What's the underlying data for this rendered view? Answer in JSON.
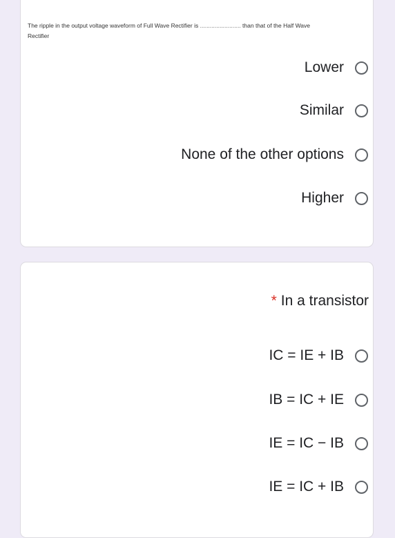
{
  "question1": {
    "text_before": "The ripple in the output voltage waveform of Full Wave Rectifier is",
    "blank": ".........................",
    "text_after": "than that of the Half Wave Rectifier",
    "options": [
      {
        "label": "Lower",
        "selected": false
      },
      {
        "label": "Similar",
        "selected": false
      },
      {
        "label": "None of the other options",
        "selected": false
      },
      {
        "label": "Higher",
        "selected": false
      }
    ]
  },
  "question2": {
    "required_marker": "*",
    "text": "In a transistor",
    "options": [
      {
        "label": "IC = IE + IB",
        "selected": false
      },
      {
        "label": "IB = IC + IE",
        "selected": false
      },
      {
        "label": "IE = IC − IB",
        "selected": false
      },
      {
        "label": "IE = IC + IB",
        "selected": false
      }
    ]
  },
  "colors": {
    "background": "#efebf7",
    "required": "#d93025",
    "radio_border": "#5f6368"
  }
}
